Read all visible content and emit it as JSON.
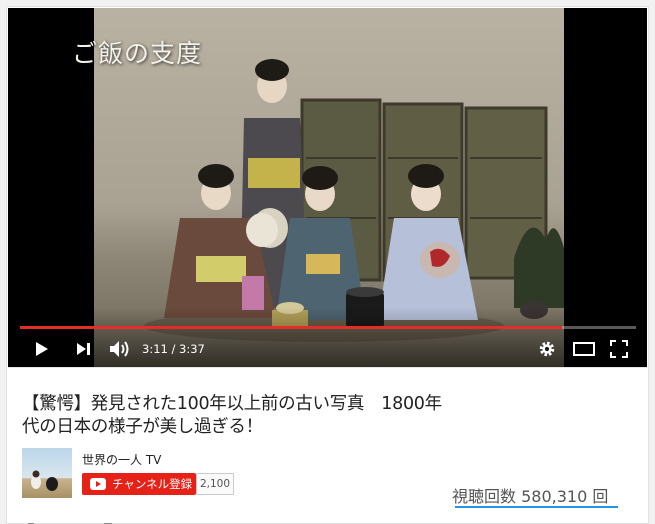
{
  "video": {
    "overlay_caption": "ご飯の支度",
    "current_time": "3:11",
    "time_separator": "/",
    "duration": "3:37",
    "progress_fraction": 0.88,
    "progress_color": "#e52d27"
  },
  "controls": {
    "play_icon": "play-icon",
    "next_icon": "next-icon",
    "volume_icon": "volume-icon",
    "settings_icon": "gear-icon",
    "theater_icon": "theater-mode-icon",
    "fullscreen_icon": "fullscreen-icon"
  },
  "info": {
    "title_line1": "【驚愕】発見された100年以上前の古い写真　1800年",
    "title_line2": "代の日本の様子が美し過ぎる！",
    "channel_name": "世界の一人 TV",
    "subscribe_label": "チャンネル登録",
    "subscriber_count": "2,100",
    "views": "視聴回数 580,310 回",
    "subscribe_color": "#e62117",
    "like_bar_color": "#2793e6"
  }
}
